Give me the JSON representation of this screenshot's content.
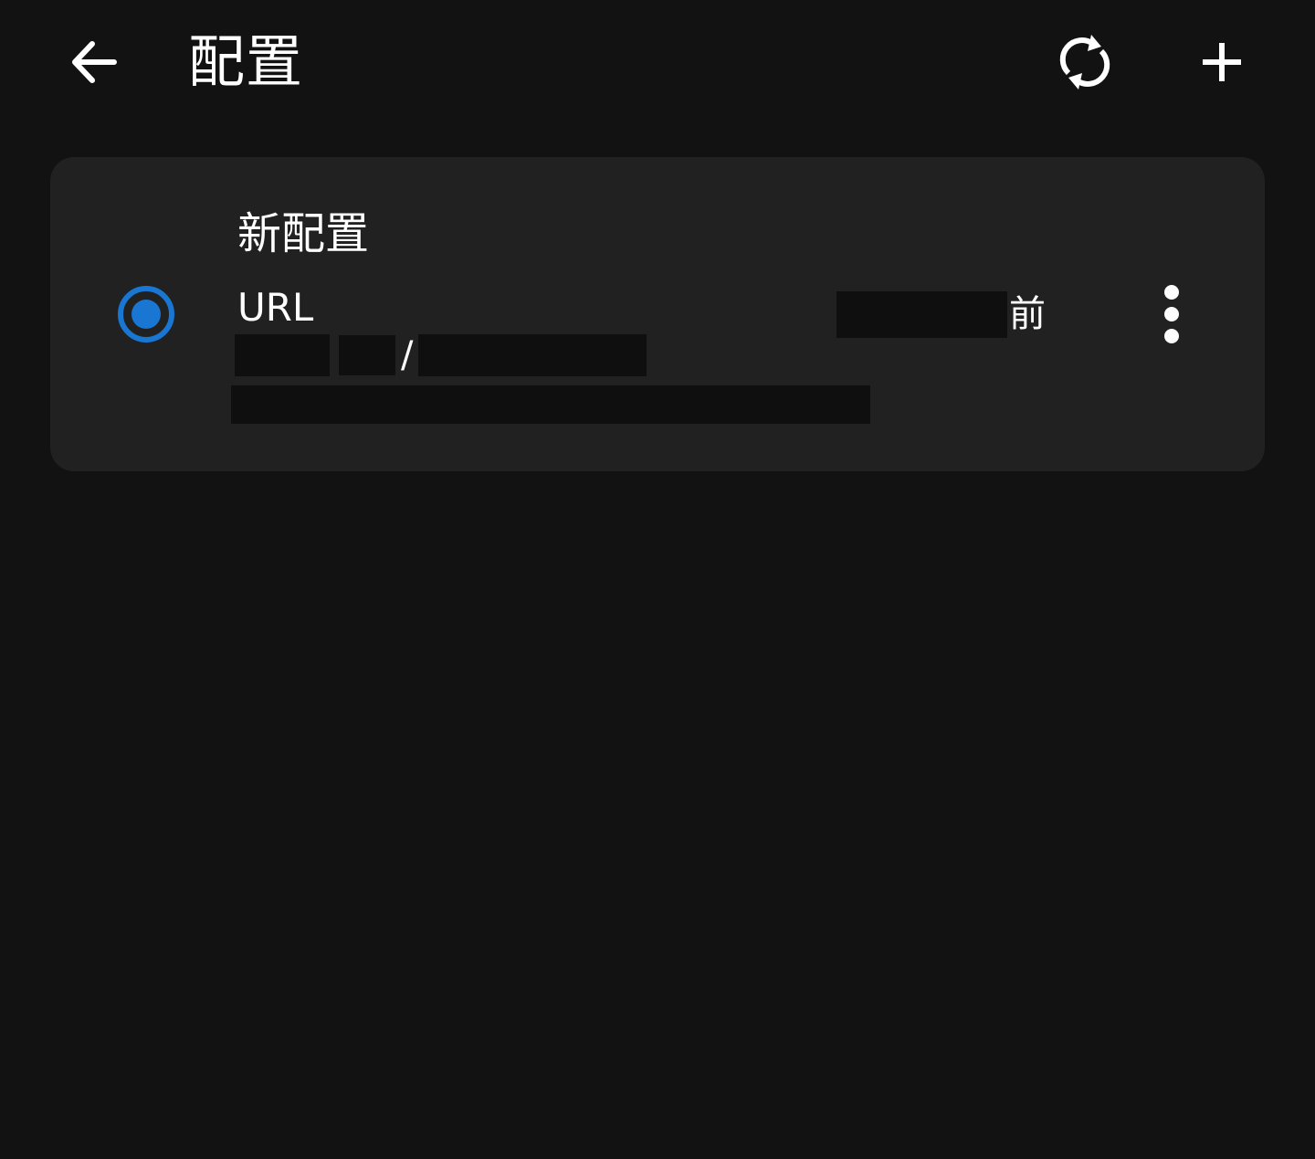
{
  "appbar": {
    "title": "配置",
    "back_icon": "arrow-left-icon",
    "refresh_icon": "sync-icon",
    "add_icon": "plus-icon"
  },
  "profiles": [
    {
      "name": "新配置",
      "type": "URL",
      "updated_suffix": "前",
      "url_separator": "/",
      "selected": true,
      "more_icon": "more-vert-icon"
    }
  ],
  "colors": {
    "background": "#121212",
    "card": "#212121",
    "accent": "#1976D2",
    "text": "#FFFFFF",
    "redaction": "#0F0F0F"
  }
}
